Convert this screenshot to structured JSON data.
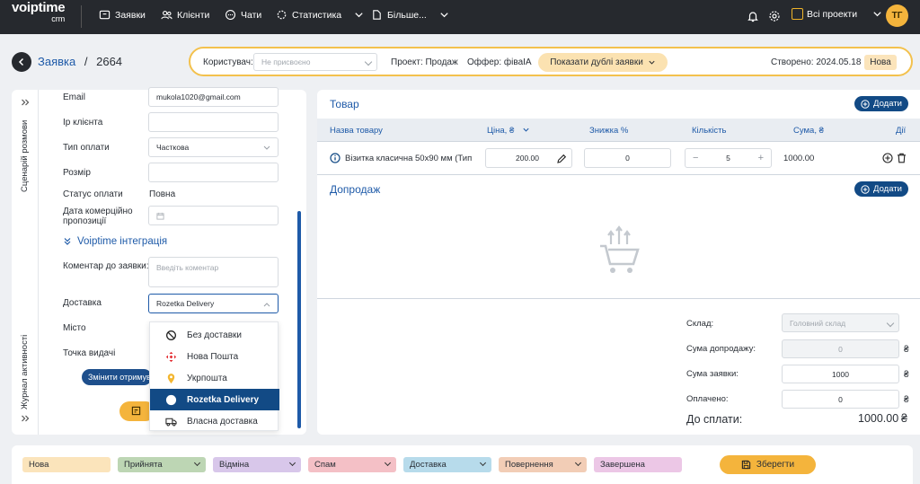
{
  "topbar": {
    "logo_main": "voiptime",
    "logo_sub": "crm",
    "nav": [
      "Заявки",
      "Клієнти",
      "Чати",
      "Статистика",
      "Більше..."
    ],
    "projects_label": "Всі проекти",
    "avatar_initials": "ТГ"
  },
  "header": {
    "crumb_link": "Заявка",
    "crumb_sep": "/",
    "crumb_id": "2664",
    "user_label": "Користувач:",
    "user_placeholder": "Не присвоєно",
    "project_text": "Проект: Продаж",
    "offer_text": "Оффер: фіваІА",
    "duplicates_button": "Показати дублі заявки",
    "created_text": "Створено: 2024.05.18",
    "status_badge": "Нова"
  },
  "sidetabs": {
    "scenario": "Сценарій розмови",
    "journal": "Журнал активності"
  },
  "form": {
    "email_label": "Email",
    "email_value": "mukola1020@gmail.com",
    "ip_label": "Ip клієнта",
    "payment_type_label": "Тип оплати",
    "payment_type_value": "Часткова",
    "size_label": "Розмір",
    "payment_status_label": "Статус оплати",
    "payment_status_value": "Повна",
    "offer_date_label_1": "Дата комерційно",
    "offer_date_label_2": "пропозиції",
    "integration_title": "Voiptime інтеграція",
    "comment_label": "Коментар до заявки:",
    "comment_placeholder": "Введіть коментар",
    "delivery_label": "Доставка",
    "delivery_value": "Rozetka Delivery",
    "city_label": "Місто",
    "pickup_label": "Точка видачі",
    "change_recipient_button": "Змінити отримува"
  },
  "delivery_options": [
    {
      "label": "Без доставки",
      "icon": "no-delivery-icon"
    },
    {
      "label": "Нова Пошта",
      "icon": "nova-poshta-icon"
    },
    {
      "label": "Укрпошта",
      "icon": "ukrposhta-icon"
    },
    {
      "label": "Rozetka Delivery",
      "icon": "rozetka-icon",
      "active": true
    },
    {
      "label": "Власна доставка",
      "icon": "truck-icon"
    }
  ],
  "products": {
    "title": "Товар",
    "add_button": "Додати",
    "columns": [
      "Назва товару",
      "Ціна, ₴",
      "Знижка %",
      "Кількість",
      "Сума, ₴",
      "Дії"
    ],
    "row": {
      "name": "Візитка класична 50х90 мм (Тип",
      "price": "200.00",
      "discount": "0",
      "quantity": "5",
      "sum": "1000.00"
    }
  },
  "upsell": {
    "title": "Допродаж",
    "add_button": "Додати"
  },
  "summary": {
    "warehouse_label": "Склад:",
    "warehouse_value": "Головний склад",
    "upsell_sum_label": "Сума допродажу:",
    "upsell_sum_value": "0",
    "order_sum_label": "Сума заявки:",
    "order_sum_value": "1000",
    "paid_label": "Оплачено:",
    "paid_value": "0",
    "to_pay_label": "До сплати:",
    "to_pay_value": "1000.00",
    "currency": "₴"
  },
  "statuses": [
    {
      "label": "Нова",
      "color": "#fbe4bb"
    },
    {
      "label": "Прийнята",
      "color": "#bdd6b4"
    },
    {
      "label": "Відміна",
      "color": "#d8c7ea"
    },
    {
      "label": "Спам",
      "color": "#f4c0c6"
    },
    {
      "label": "Доставка",
      "color": "#b7dbeb"
    },
    {
      "label": "Повернення",
      "color": "#f2cdb6"
    },
    {
      "label": "Завершена",
      "color": "#ecc7e6"
    }
  ],
  "save_button": "Зберегти"
}
